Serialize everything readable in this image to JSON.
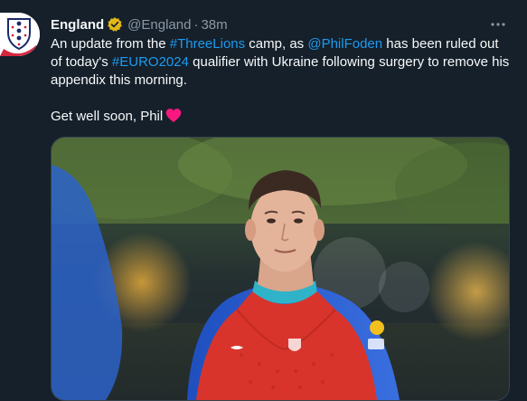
{
  "author": {
    "name": "England",
    "handle": "@England",
    "separator": "·",
    "time": "38m",
    "verified_badge_icon": "gold-verified-badge-icon",
    "avatar_icon": "three-lions-crest-icon"
  },
  "menu_icon": "more-horizontal-icon",
  "tweet": {
    "line1_prefix": "An update from the ",
    "hashtag1": "#ThreeLions",
    "line1_mid": " camp, as ",
    "mention": "@PhilFoden",
    "line1_suffix": " has been ruled out of today's ",
    "hashtag2": "#EURO2024",
    "line1_end": " qualifier with Ukraine following surgery to remove his appendix this morning.",
    "line2": "Get well soon, Phil",
    "emoji_icon": "red-heart-icon"
  },
  "media": {
    "kind": "photo",
    "icon": "player-training-photo"
  },
  "colors": {
    "background": "#15202b",
    "text": "#f7f9f9",
    "secondary": "#8b98a5",
    "link": "#1d9bf0",
    "heart": "#f91880",
    "verified": "#e2b719"
  }
}
